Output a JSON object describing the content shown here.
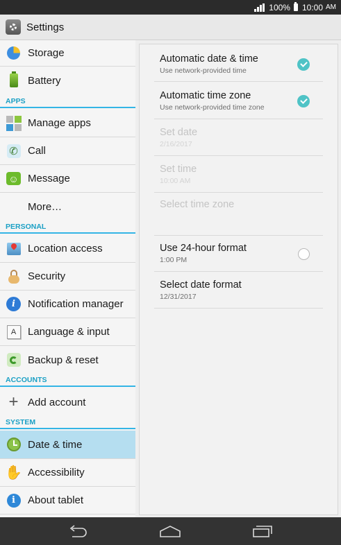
{
  "status_bar": {
    "battery_percent": "100%",
    "time": "10:00",
    "ampm": "AM"
  },
  "action_bar": {
    "title": "Settings",
    "icon": "settings-gear-icon"
  },
  "menu": {
    "headers": {
      "apps": "APPS",
      "personal": "PERSONAL",
      "accounts": "ACCOUNTS",
      "system": "SYSTEM"
    },
    "items": {
      "storage": "Storage",
      "battery": "Battery",
      "manage_apps": "Manage apps",
      "call": "Call",
      "message": "Message",
      "more": "More…",
      "location_access": "Location access",
      "security": "Security",
      "notification_manager": "Notification manager",
      "language_input": "Language & input",
      "backup_reset": "Backup & reset",
      "add_account": "Add account",
      "date_time": "Date & time",
      "accessibility": "Accessibility",
      "about_tablet": "About tablet"
    },
    "selected": "date_time"
  },
  "date_time": {
    "auto_date_time": {
      "title": "Automatic date & time",
      "summary": "Use network-provided time",
      "checked": true
    },
    "auto_time_zone": {
      "title": "Automatic time zone",
      "summary": "Use network-provided time zone",
      "checked": true
    },
    "set_date": {
      "title": "Set date",
      "summary": "2/16/2017",
      "enabled": false
    },
    "set_time": {
      "title": "Set time",
      "summary": "10:00 AM",
      "enabled": false
    },
    "select_time_zone": {
      "title": "Select time zone",
      "enabled": false
    },
    "use_24_hour": {
      "title": "Use 24-hour format",
      "summary": "1:00 PM",
      "checked": false
    },
    "select_date_format": {
      "title": "Select date format",
      "summary": "12/31/2017"
    }
  },
  "colors": {
    "accent": "#33b5e5",
    "selected_bg": "#b5def0",
    "checkbox": "#4fc3c6"
  }
}
